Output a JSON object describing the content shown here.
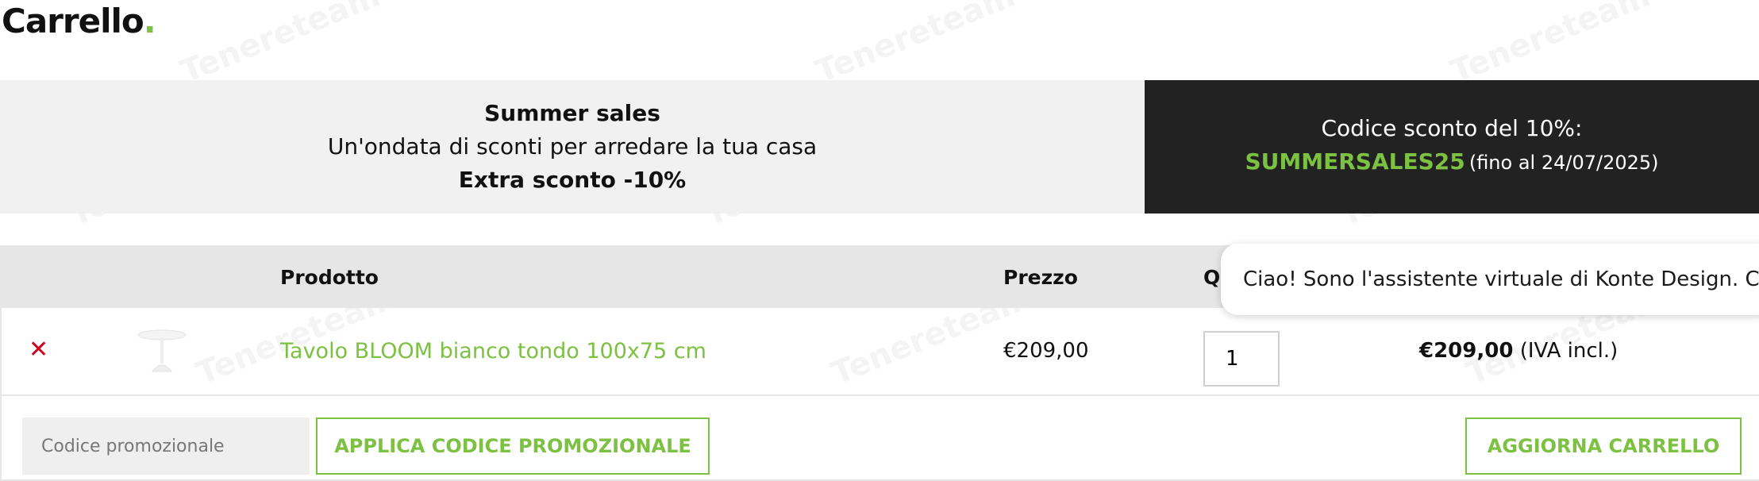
{
  "page": {
    "title": "Carrello",
    "title_dot": "."
  },
  "promo": {
    "line1": "Summer sales",
    "line2": "Un'ondata di sconti per arredare la tua casa",
    "line3": "Extra sconto -10%",
    "discount_label": "Codice sconto del 10%:",
    "code": "SUMMERSALES25",
    "until": "(fino al 24/07/2025)"
  },
  "table": {
    "headers": {
      "product": "Prodotto",
      "price": "Prezzo",
      "quantity": "Qu"
    },
    "rows": [
      {
        "remove_icon": "close-icon",
        "name": "Tavolo BLOOM bianco tondo 100x75 cm",
        "price": "€209,00",
        "quantity": "1",
        "subtotal": "€209,00",
        "subtotal_note": "(IVA incl.)"
      }
    ]
  },
  "actions": {
    "coupon_placeholder": "Codice promozionale",
    "apply_label": "APPLICA CODICE PROMOZIONALE",
    "update_label": "AGGIORNA CARRELLO"
  },
  "chat": {
    "message": "Ciao! Sono l'assistente virtuale di Konte Design. C"
  },
  "watermark": {
    "text": "Tenereteam"
  },
  "colors": {
    "accent": "#7cc142",
    "dark_banner": "#232222",
    "light_banner": "#f1f1f1",
    "remove": "#d0021b"
  }
}
